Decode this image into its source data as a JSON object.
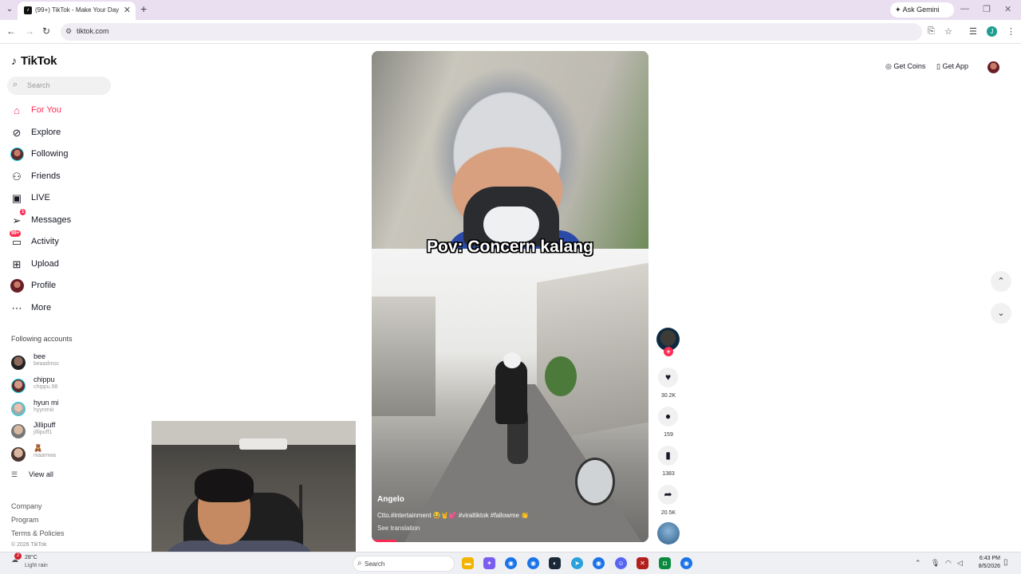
{
  "browser": {
    "tab_title": "(99+) TikTok - Make Your Day",
    "new_tab": "+",
    "ask_gemini": "Ask Gemini",
    "url": "tiktok.com",
    "profile_initial": "J"
  },
  "sidebar": {
    "logo": "TikTok",
    "search_placeholder": "Search",
    "nav": [
      {
        "label": "For You",
        "icon": "home-icon"
      },
      {
        "label": "Explore",
        "icon": "compass-icon"
      },
      {
        "label": "Following",
        "icon": "avatar"
      },
      {
        "label": "Friends",
        "icon": "friends-icon"
      },
      {
        "label": "LIVE",
        "icon": "live-icon"
      },
      {
        "label": "Messages",
        "icon": "send-icon",
        "badge": "1"
      },
      {
        "label": "Activity",
        "icon": "inbox-icon",
        "badge": "99+"
      },
      {
        "label": "Upload",
        "icon": "plus-square-icon"
      },
      {
        "label": "Profile",
        "icon": "avatar"
      },
      {
        "label": "More",
        "icon": "more-icon"
      }
    ],
    "following_title": "Following accounts",
    "accounts": [
      {
        "name": "bee",
        "handle": "beaadmsc"
      },
      {
        "name": "chippu",
        "handle": "chippu.98"
      },
      {
        "name": "hyun mi",
        "handle": "hyynmiii"
      },
      {
        "name": "Jillipuff",
        "handle": "jillipuff1"
      },
      {
        "name": "🧸",
        "handle": "niaamwa"
      }
    ],
    "view_all": "View all",
    "footer": [
      "Company",
      "Program",
      "Terms & Policies"
    ],
    "copyright": "© 2026 TikTok"
  },
  "topright": {
    "get_coins": "Get Coins",
    "get_app": "Get App"
  },
  "video": {
    "caption": "Pov: Concern kalang",
    "author": "Angelo",
    "description": "Ctto.#intertainment 😂🤘💕 #viraltiktok #fallowme 👏",
    "see_translation": "See translation",
    "likes": "30.2K",
    "comments": "159",
    "saves": "1383",
    "shares": "20.5K",
    "progress": 0.09
  },
  "taskbar": {
    "temp": "28°C",
    "weather": "Light rain",
    "weather_badge": "2",
    "search": "Search",
    "time": "6:43 PM",
    "date": "8/5/2026"
  },
  "colors": {
    "accent": "#fe2c55",
    "live_ring": "#20d5ec"
  }
}
